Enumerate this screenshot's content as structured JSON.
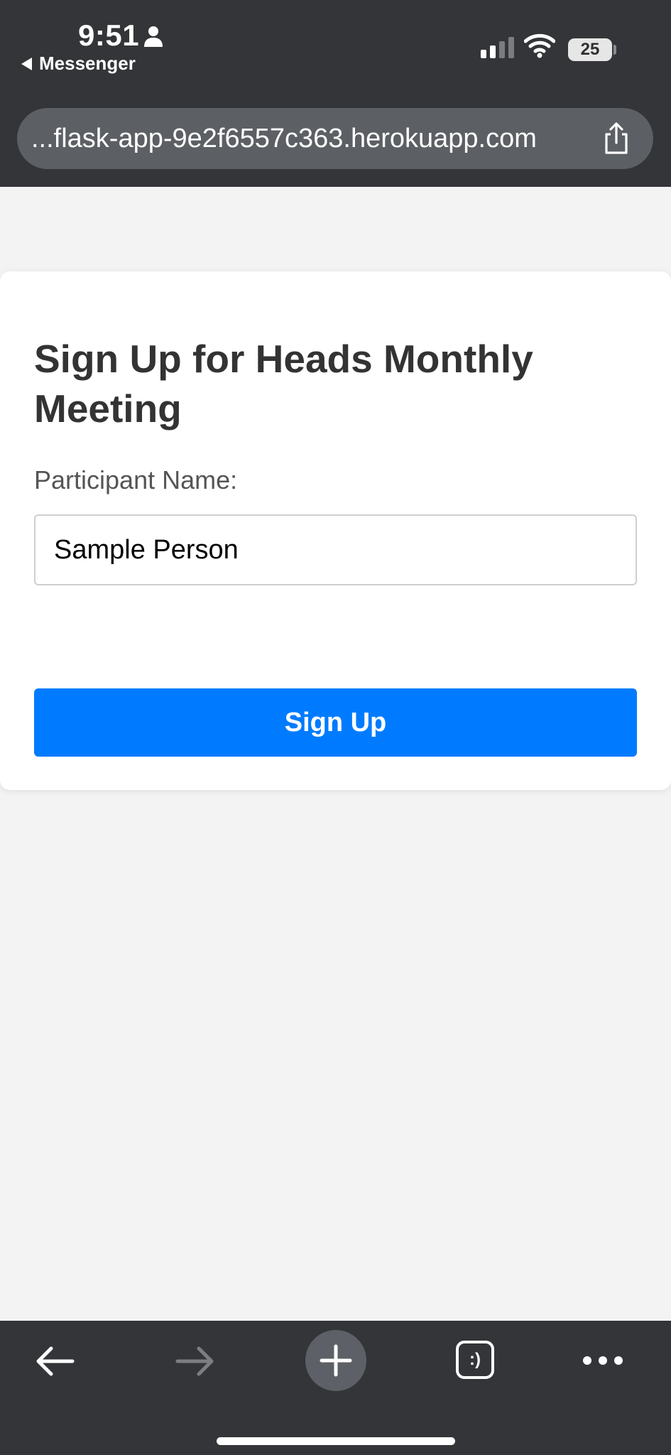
{
  "status_bar": {
    "time": "9:51",
    "back_app": "Messenger",
    "battery": "25"
  },
  "browser": {
    "url": "...flask-app-9e2f6557c363.herokuapp.com"
  },
  "form": {
    "title": "Sign Up for Heads Monthly Meeting",
    "name_label": "Participant Name:",
    "name_value": "Sample Person",
    "submit_label": "Sign Up"
  },
  "toolbar": {
    "tabs_label": ":)"
  },
  "icons": {
    "person": "person-icon",
    "signal": "cellular-signal-icon",
    "wifi": "wifi-icon",
    "share": "share-icon",
    "back": "back-arrow-icon",
    "forward": "forward-arrow-icon",
    "new_tab": "plus-icon",
    "tabs": "tabs-icon",
    "more": "more-icon"
  },
  "colors": {
    "chrome": "#333538",
    "url_bar": "#5c5f64",
    "page_bg": "#f3f3f3",
    "button": "#007bff"
  }
}
